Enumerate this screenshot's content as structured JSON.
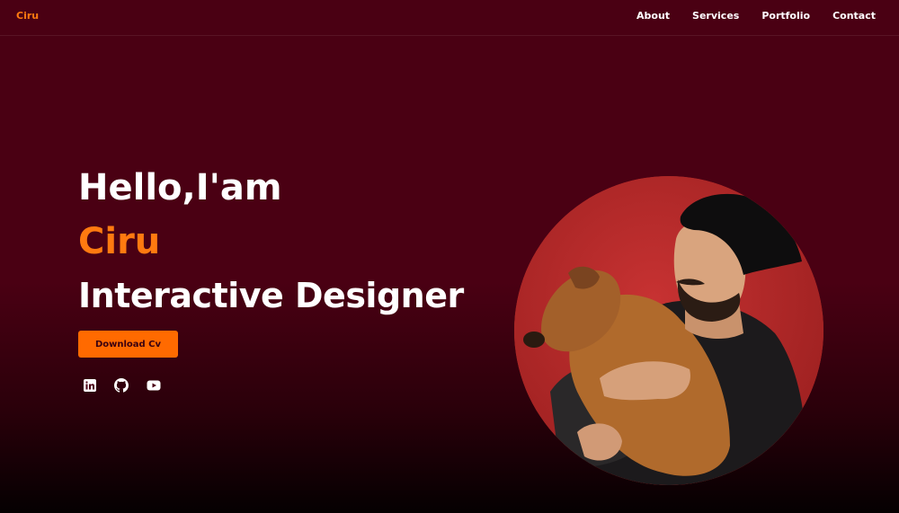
{
  "nav": {
    "logo": "Ciru",
    "links": [
      "About",
      "Services",
      "Portfolio",
      "Contact"
    ]
  },
  "hero": {
    "greeting": "Hello,I'am",
    "name": "Ciru",
    "role": "Interactive Designer",
    "button_label": "Download Cv"
  },
  "socials": [
    "linkedin-icon",
    "github-icon",
    "youtube-icon"
  ],
  "colors": {
    "background": "#4a0013",
    "accent": "#ff7a10",
    "button": "#ff6a00",
    "portrait_bg": "#b02626"
  }
}
